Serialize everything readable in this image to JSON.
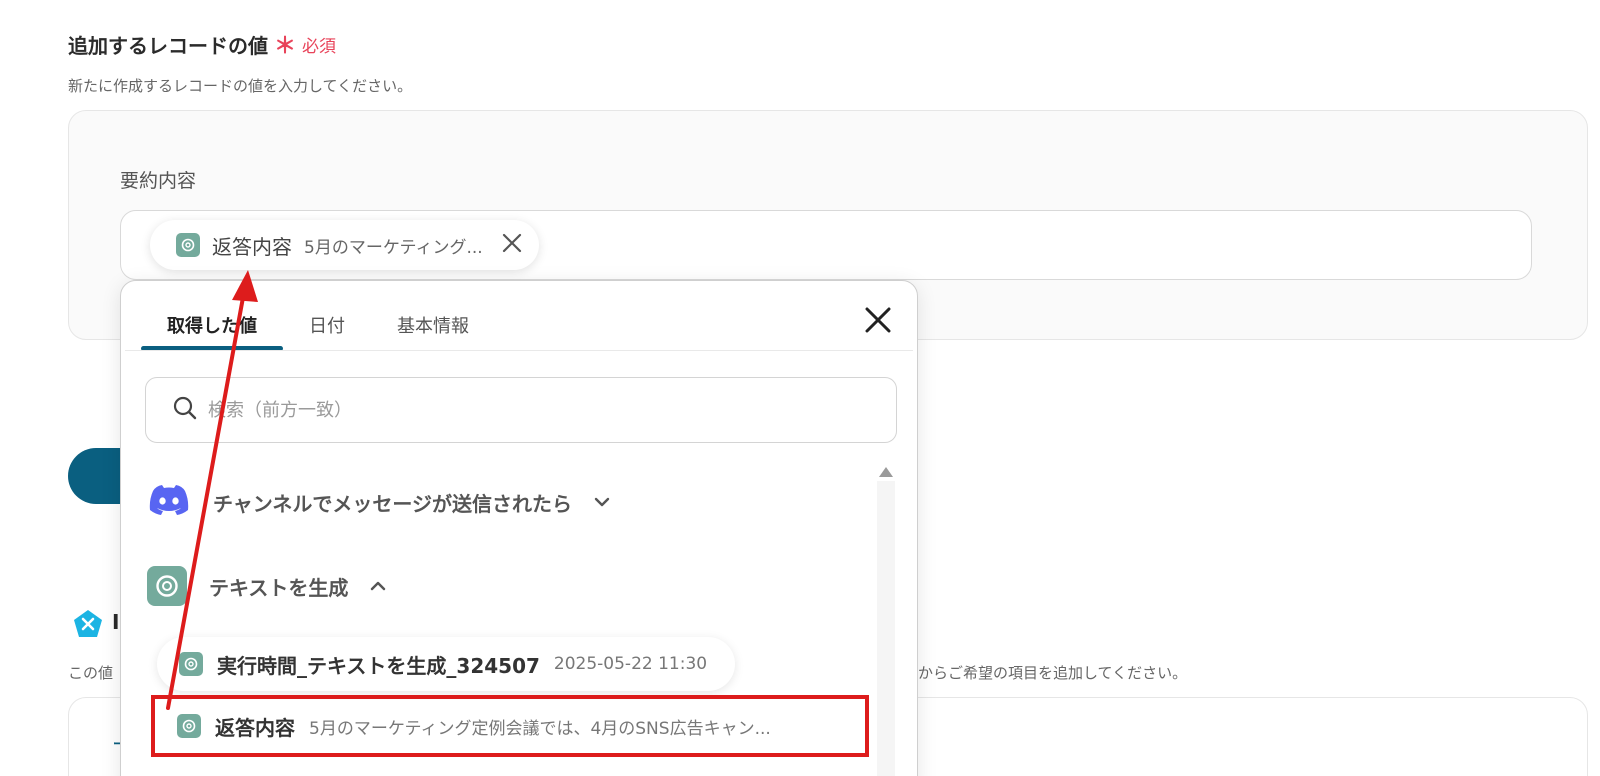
{
  "section": {
    "title": "追加するレコードの値",
    "required_star": "＊",
    "required_label": "必須",
    "description": "新たに作成するレコードの値を入力してください。"
  },
  "field": {
    "label": "要約内容",
    "chip": {
      "icon": "chatgpt-icon",
      "name": "返答内容",
      "value": "5月のマーケティング..."
    }
  },
  "behind": {
    "title_partial": "I",
    "desc_left": "この値",
    "desc_right": "からご希望の項目を追加してください。",
    "panel_glyph": "ー"
  },
  "dropdown": {
    "tabs": [
      "取得した値",
      "日付",
      "基本情報"
    ],
    "active_tab": "取得した値",
    "search_placeholder": "検索（前方一致）",
    "groups": [
      {
        "label": "チャンネルでメッセージが送信されたら",
        "icon": "discord-icon",
        "expanded": false
      },
      {
        "label": "テキストを生成",
        "icon": "chatgpt-icon",
        "expanded": true
      }
    ],
    "items": [
      {
        "name": "実行時間_テキストを生成_324507",
        "value": "2025-05-22 11:30",
        "icon": "chatgpt-icon"
      },
      {
        "name": "返答内容",
        "value": "5月のマーケティング定例会議では、4月のSNS広告キャン...",
        "icon": "chatgpt-icon",
        "highlighted": true
      }
    ]
  },
  "colors": {
    "accent": "#0a5f80",
    "required": "#e8435a",
    "annotation": "#dd1c1c",
    "chatgpt": "#74aa9c",
    "discord": "#5865f2"
  }
}
